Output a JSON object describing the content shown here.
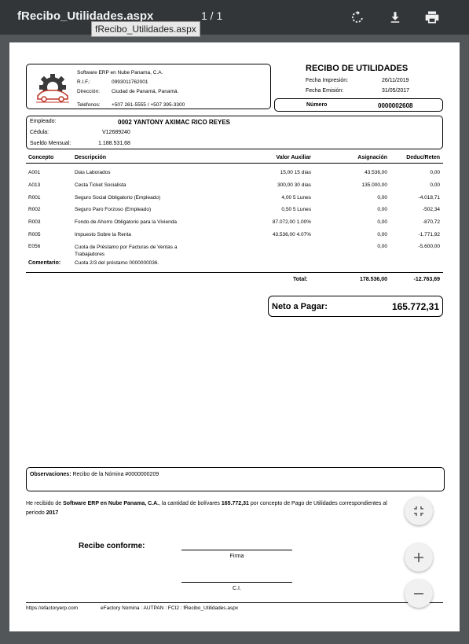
{
  "viewer": {
    "title": "fRecibo_Utilidades.aspx",
    "page_indicator": "1 / 1",
    "tooltip": "fRecibo_Utilidades.aspx"
  },
  "company": {
    "name": "Software ERP en Nube Panama, C.A.",
    "rif_label": "R.I.F.:",
    "rif": "0993011762001",
    "address_label": "Dirección:",
    "address": "Ciudad de Panamá, Panamá.",
    "phones_label": "Teléfonos:",
    "phones": "+507 261-5555 / +507 395-3300"
  },
  "receipt": {
    "title": "RECIBO DE UTILIDADES",
    "print_date_label": "Fecha Impresión:",
    "print_date": "26/11/2019",
    "issue_date_label": "Fecha Emisión:",
    "issue_date": "31/05/2017",
    "number_label": "Número",
    "number": "0000002608"
  },
  "employee": {
    "employee_label": "Empleado:",
    "employee": "0002 YANTONY AXIMAC RICO REYES",
    "id_label": "Cédula:",
    "id": "V12689240",
    "salary_label": "Sueldo  Mensual:",
    "salary": "1.188.531,68"
  },
  "table": {
    "headers": [
      "Concepto",
      "Descripción",
      "Valor Auxiliar",
      "Asignación",
      "Deduc/Reten"
    ],
    "rows": [
      {
        "code": "A001",
        "desc": "Dias Laborados",
        "aux": "15,00 15 días",
        "asig": "43.536,00",
        "ded": "0,00"
      },
      {
        "code": "A013",
        "desc": "Cesta Ticket Socialista",
        "aux": "300,00 30 días",
        "asig": "135.000,00",
        "ded": "0,00"
      },
      {
        "code": "R001",
        "desc": "Seguro Social Obligatorio (Empleado)",
        "aux": "4,00 5 Lunes",
        "asig": "0,00",
        "ded": "-4.018,71"
      },
      {
        "code": "R002",
        "desc": "Seguro Paro Forzoso (Empleado)",
        "aux": "0,50 5 Lunes",
        "asig": "0,00",
        "ded": "-502,34"
      },
      {
        "code": "R003",
        "desc": "Fondo de Ahorro Obligatorio para la Vivienda",
        "aux": "87.072,00 1.00%",
        "asig": "0,00",
        "ded": "-870,72"
      },
      {
        "code": "R005",
        "desc": "Impuesto Sobre la Renta",
        "aux": "43.536,00 4.07%",
        "asig": "0,00",
        "ded": "-1.771,92"
      },
      {
        "code": "E056",
        "desc": "Cuota de Préstamo por Facturas de Ventas a Trabajadores",
        "aux": "",
        "asig": "0,00",
        "ded": "-5.600,00"
      }
    ],
    "comment_label": "Comentario:",
    "comment": "Cuota 2/3 del préstamo 0000000036.",
    "total_label": "Total:",
    "total_asig": "178.536,00",
    "total_ded": "-12.763,69"
  },
  "net": {
    "label": "Neto a Pagar:",
    "value": "165.772,31"
  },
  "observations": {
    "label": "Observaciones:",
    "text": "Recibo de la Nómina #0000000209"
  },
  "statement": {
    "p1": "He recibido de ",
    "company": "Software ERP en Nube Panama, C.A.",
    "p2": ", la cantidad de bolívares ",
    "amount": "165.772,31",
    "p3": " por concepto de Pago de Utilidades correspondientes al período ",
    "period": "2017"
  },
  "signature": {
    "receive_label": "Recibe conforme:",
    "firma_label": "Firma",
    "ci_label": "C.I."
  },
  "footer": {
    "site": "https://efactoryerp.com",
    "system": "eFactory Nomina  :  AUTPAN  :  FCI2  :  fRecibo_Utilidades.aspx"
  },
  "icons": [
    "rotate-icon",
    "download-icon",
    "print-icon",
    "fit-page-icon",
    "zoom-in-icon",
    "zoom-out-icon",
    "logo-gear-car"
  ]
}
